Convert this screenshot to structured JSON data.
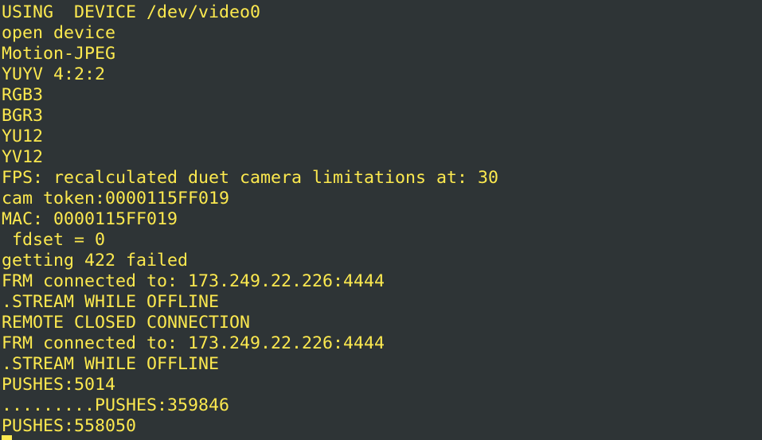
{
  "terminal": {
    "lines": [
      "USING  DEVICE /dev/video0",
      "open device",
      "Motion-JPEG",
      "YUYV 4:2:2",
      "RGB3",
      "BGR3",
      "YU12",
      "YV12",
      "FPS: recalculated duet camera limitations at: 30",
      "cam token:0000115FF019",
      "MAC: 0000115FF019",
      " fdset = 0",
      "getting 422 failed",
      "FRM connected to: 173.249.22.226:4444",
      ".STREAM WHILE OFFLINE",
      "REMOTE CLOSED CONNECTION",
      "FRM connected to: 173.249.22.226:4444",
      ".STREAM WHILE OFFLINE",
      "PUSHES:5014",
      ".........PUSHES:359846",
      "PUSHES:558050"
    ],
    "text_color": "#fce94f",
    "background_color": "#2e3436"
  }
}
